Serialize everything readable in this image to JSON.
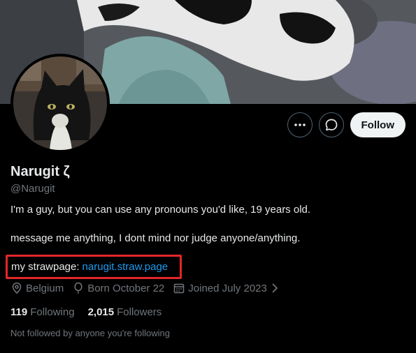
{
  "profile": {
    "name": "Narugit ζ",
    "handle": "@Narugit",
    "bio_line1": "I'm a guy, but you can use any pronouns you'd like, 19 years old.",
    "bio_line2": "message me anything, I dont mind nor judge anyone/anything.",
    "link_prefix": "my strawpage:",
    "link_text": "narugit.straw.page",
    "location": "Belgium",
    "birthday": "Born October 22",
    "joined": "Joined July 2023",
    "following_count": "119",
    "following_label": "Following",
    "followers_count": "2,015",
    "followers_label": "Followers",
    "followed_by_note": "Not followed by anyone you're following"
  },
  "actions": {
    "follow_label": "Follow",
    "more_icon": "more-icon",
    "message_icon": "message-icon"
  },
  "colors": {
    "background": "#000000",
    "link": "#1d9bf0",
    "muted": "#71767b",
    "highlight_border": "#e2262b"
  }
}
